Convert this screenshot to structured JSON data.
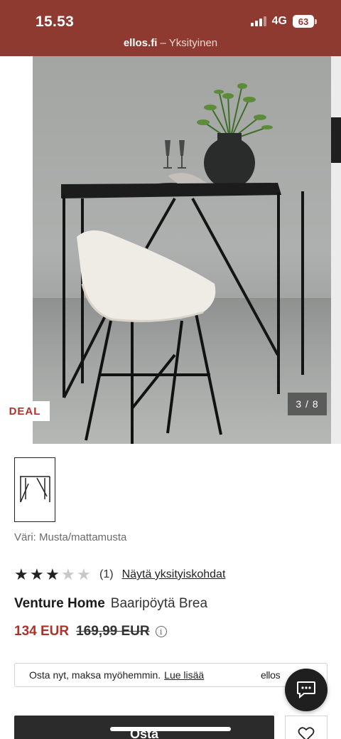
{
  "status_bar": {
    "time": "15.53",
    "network": "4G",
    "battery": "63"
  },
  "browser": {
    "domain": "ellos.fi",
    "mode": "– Yksityinen"
  },
  "gallery": {
    "badge": "DEAL",
    "counter": "3 / 8",
    "current_image": 3,
    "total_images": 8
  },
  "product": {
    "color_label": "Väri: Musta/mattamusta",
    "rating": 3,
    "rating_max": 5,
    "review_count": "(1)",
    "review_link": "Näytä yksityiskohdat",
    "brand": "Venture Home",
    "name": "Baaripöytä Brea",
    "price": "134 EUR",
    "old_price": "169,99 EUR",
    "info_icon": "i"
  },
  "pay_later": {
    "text": "Osta nyt, maksa myöhemmin.",
    "link": "Lue lisää",
    "brand": "ellos"
  },
  "actions": {
    "buy_label": "Osta"
  },
  "colors": {
    "status_bar": "#8e3a31",
    "price": "#b2302a",
    "deal": "#b2302a",
    "button": "#2b2b2b"
  },
  "icons": [
    "signal-icon",
    "battery-icon",
    "info-icon",
    "chat-icon",
    "heart-icon",
    "star-icon"
  ]
}
